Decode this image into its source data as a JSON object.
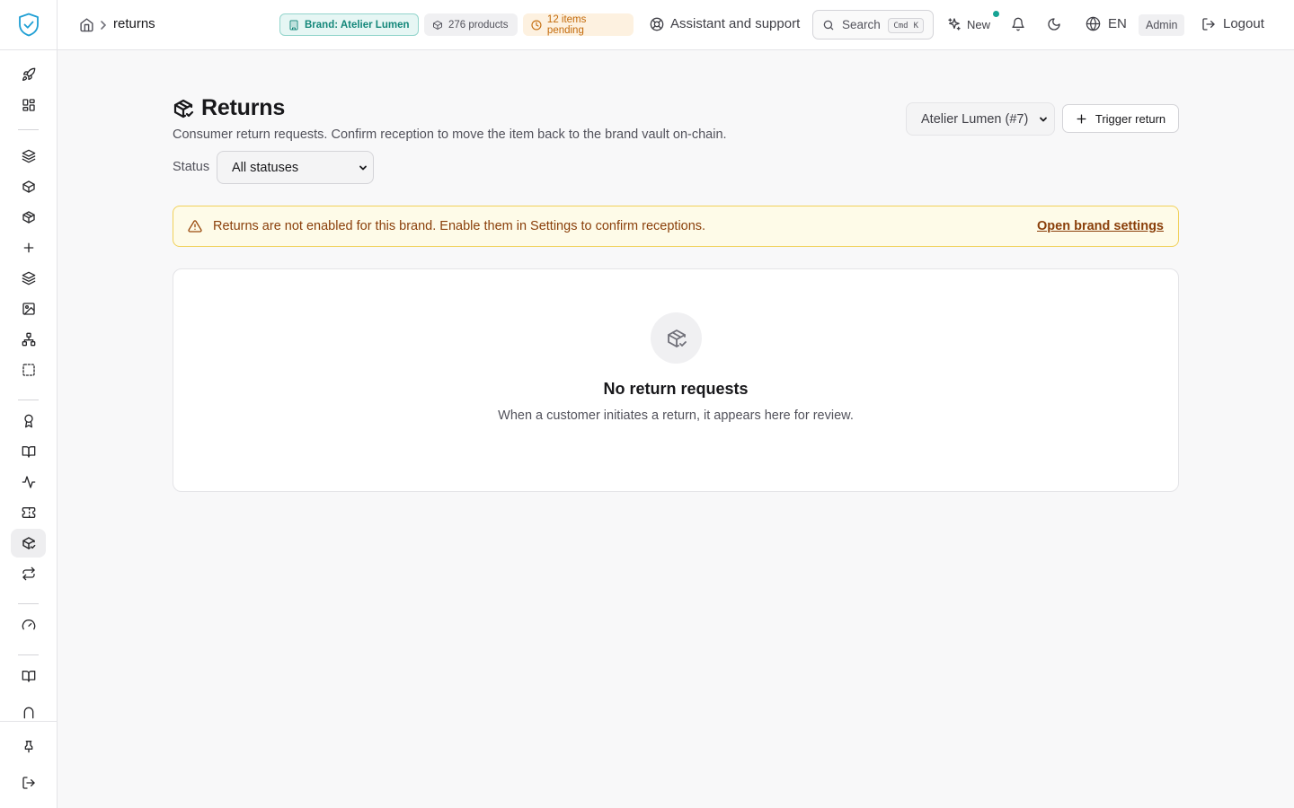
{
  "sidebar": {
    "logo_icon": "shield-check-icon",
    "items": [
      {
        "icon": "rocket-icon"
      },
      {
        "icon": "dashboard-grid-icon"
      },
      {
        "icon": "layers-icon"
      },
      {
        "icon": "box-icon"
      },
      {
        "icon": "package-icon"
      },
      {
        "icon": "plus-icon"
      },
      {
        "icon": "stack-icon"
      },
      {
        "icon": "image-icon"
      },
      {
        "icon": "network-icon"
      },
      {
        "icon": "selection-icon"
      },
      {
        "icon": "award-icon"
      },
      {
        "icon": "book-open-icon"
      },
      {
        "icon": "activity-icon"
      },
      {
        "icon": "ticket-icon"
      },
      {
        "icon": "package-check-icon",
        "active": true
      },
      {
        "icon": "repeat-icon"
      },
      {
        "icon": "gauge-icon"
      },
      {
        "icon": "book-icon"
      },
      {
        "icon": "arch-icon"
      },
      {
        "icon": "pin-icon"
      },
      {
        "icon": "logout-icon"
      }
    ]
  },
  "header": {
    "breadcrumb_current": "returns",
    "brand_chip": "Brand: Atelier Lumen",
    "products_chip": "276 products",
    "pending_chip": "12 items pending",
    "support_label": "Assistant and support",
    "search_label": "Search",
    "search_kbd_1": "Cmd",
    "search_kbd_2": "K",
    "new_label": "New",
    "language": "EN",
    "role": "Admin",
    "logout_label": "Logout"
  },
  "main": {
    "title": "Returns",
    "subtitle": "Consumer return requests. Confirm reception to move the item back to the brand vault on-chain.",
    "status_label": "Status",
    "status_value": "All statuses",
    "brand_select_value": "Atelier Lumen (#7)",
    "trigger_label": "Trigger return",
    "alert_text": "Returns are not enabled for this brand. Enable them in Settings to confirm receptions.",
    "alert_link": "Open brand settings",
    "empty_title": "No return requests",
    "empty_desc": "When a customer initiates a return, it appears here for review."
  },
  "colors": {
    "accent": "#14877a",
    "warning_bg": "#fefbe8",
    "warning_text": "#8a3f0a",
    "pending": "#c36a0a"
  }
}
